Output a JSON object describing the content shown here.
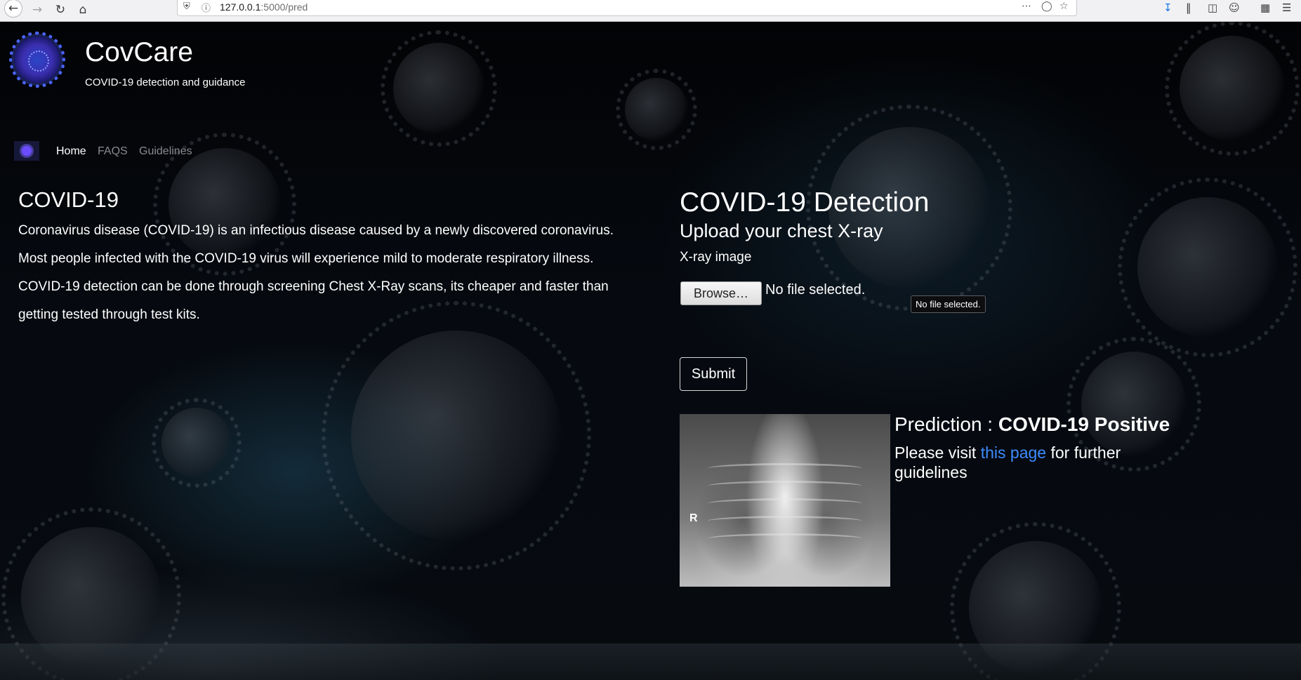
{
  "browser": {
    "url_host": "127.0.0.1",
    "url_path": ":5000/pred"
  },
  "icons": [
    "back-icon",
    "forward-icon",
    "reload-icon",
    "home-icon",
    "shield-icon",
    "info-icon",
    "more-icon",
    "pocket-icon",
    "star-icon",
    "download-icon",
    "library-icon",
    "sidebar-icon",
    "account-icon",
    "extensions-icon",
    "menu-icon"
  ],
  "brand": {
    "title": "CovCare",
    "subtitle": "COVID-19 detection and guidance"
  },
  "nav": {
    "items": [
      {
        "label": "Home",
        "active": true
      },
      {
        "label": "FAQS",
        "active": false
      },
      {
        "label": "Guidelines",
        "active": false
      }
    ]
  },
  "about": {
    "title": "COVID-19",
    "body": "Coronavirus disease (COVID-19) is an infectious disease caused by a newly discovered coronavirus. Most people infected with the COVID-19 virus will experience mild to moderate respiratory illness. COVID-19 detection can be done through screening Chest X-Ray scans, its cheaper and faster than getting tested through test kits."
  },
  "detection": {
    "title": "COVID-19 Detection",
    "upload_heading": "Upload your chest X-ray",
    "field_label": "X-ray image",
    "browse_label": "Browse…",
    "file_status": "No file selected.",
    "tooltip": "No file selected.",
    "submit_label": "Submit",
    "xray_marker": "R"
  },
  "result": {
    "prefix": "Prediction : ",
    "value": "COVID-19 Positive",
    "visit_prefix": "Please visit ",
    "link_text": "this page",
    "visit_suffix": " for further guidelines"
  },
  "colors": {
    "link": "#3d8bfd",
    "background": "#05070a",
    "text": "#ffffff"
  }
}
